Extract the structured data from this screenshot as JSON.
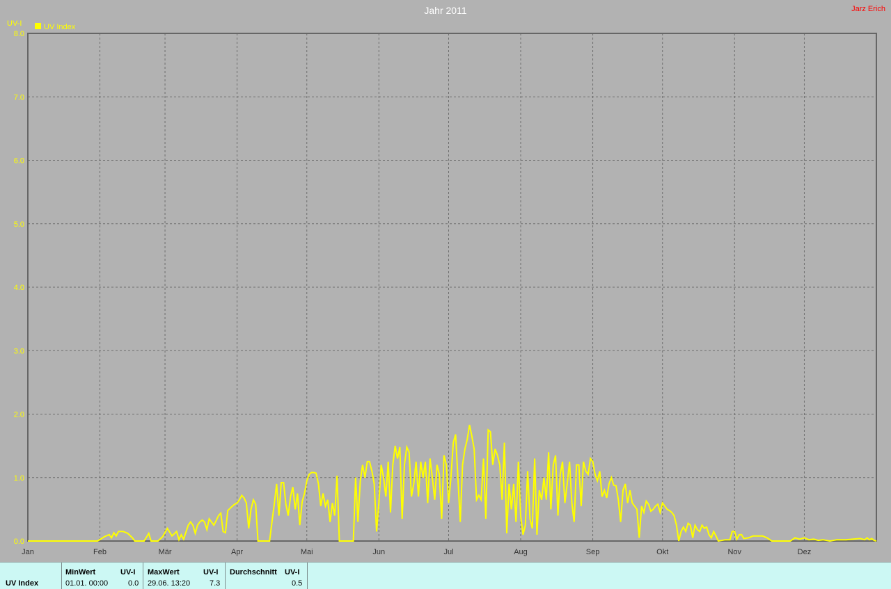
{
  "owner": "Jarz Erich",
  "chart_data": {
    "type": "line",
    "title": "Jahr 2011",
    "ylabel": "UV-I",
    "ylim": [
      0,
      8
    ],
    "yticks": [
      "0.0",
      "1.0",
      "2.0",
      "3.0",
      "4.0",
      "5.0",
      "6.0",
      "7.0",
      "8.0"
    ],
    "x_ticks": [
      "Jan",
      "Feb",
      "Mär",
      "Apr",
      "Mai",
      "Jun",
      "Jul",
      "Aug",
      "Sep",
      "Okt",
      "Nov",
      "Dez"
    ],
    "month_start_day": [
      0,
      31,
      59,
      90,
      120,
      151,
      181,
      212,
      243,
      273,
      304,
      334
    ],
    "xlim_days": [
      0,
      365
    ],
    "grid": true,
    "legend_position": "top-left",
    "series": [
      {
        "name": "UV Index",
        "color": "#ffff00",
        "points": [
          [
            0,
            0.0
          ],
          [
            30,
            0.0
          ],
          [
            33,
            0.07
          ],
          [
            35,
            0.1
          ],
          [
            36,
            0.05
          ],
          [
            37,
            0.13
          ],
          [
            38,
            0.08
          ],
          [
            39,
            0.15
          ],
          [
            41,
            0.15
          ],
          [
            43,
            0.12
          ],
          [
            45,
            0.05
          ],
          [
            46,
            0.0
          ],
          [
            50,
            0.0
          ],
          [
            52,
            0.12
          ],
          [
            53,
            0.0
          ],
          [
            56,
            0.0
          ],
          [
            58,
            0.07
          ],
          [
            60,
            0.2
          ],
          [
            62,
            0.08
          ],
          [
            64,
            0.15
          ],
          [
            65,
            0.02
          ],
          [
            66,
            0.1
          ],
          [
            67,
            0.03
          ],
          [
            69,
            0.25
          ],
          [
            70,
            0.3
          ],
          [
            71,
            0.25
          ],
          [
            72,
            0.12
          ],
          [
            73,
            0.25
          ],
          [
            74,
            0.3
          ],
          [
            75,
            0.33
          ],
          [
            76,
            0.3
          ],
          [
            77,
            0.18
          ],
          [
            78,
            0.35
          ],
          [
            79,
            0.3
          ],
          [
            80,
            0.25
          ],
          [
            81,
            0.32
          ],
          [
            82,
            0.4
          ],
          [
            83,
            0.44
          ],
          [
            84,
            0.15
          ],
          [
            85,
            0.13
          ],
          [
            86,
            0.48
          ],
          [
            88,
            0.55
          ],
          [
            89,
            0.58
          ],
          [
            90,
            0.6
          ],
          [
            91,
            0.65
          ],
          [
            92,
            0.72
          ],
          [
            93,
            0.68
          ],
          [
            94,
            0.6
          ],
          [
            95,
            0.2
          ],
          [
            96,
            0.5
          ],
          [
            97,
            0.65
          ],
          [
            98,
            0.58
          ],
          [
            99,
            0.0
          ],
          [
            104,
            0.0
          ],
          [
            105,
            0.3
          ],
          [
            106,
            0.58
          ],
          [
            107,
            0.9
          ],
          [
            108,
            0.4
          ],
          [
            109,
            0.92
          ],
          [
            110,
            0.92
          ],
          [
            111,
            0.58
          ],
          [
            112,
            0.4
          ],
          [
            113,
            0.7
          ],
          [
            114,
            0.85
          ],
          [
            115,
            0.5
          ],
          [
            116,
            0.75
          ],
          [
            117,
            0.25
          ],
          [
            118,
            0.62
          ],
          [
            119,
            0.75
          ],
          [
            120,
            0.95
          ],
          [
            121,
            1.05
          ],
          [
            122,
            1.08
          ],
          [
            123,
            1.08
          ],
          [
            124,
            1.07
          ],
          [
            125,
            0.9
          ],
          [
            126,
            0.55
          ],
          [
            127,
            0.75
          ],
          [
            128,
            0.55
          ],
          [
            129,
            0.65
          ],
          [
            130,
            0.3
          ],
          [
            131,
            0.6
          ],
          [
            132,
            0.4
          ],
          [
            133,
            1.03
          ],
          [
            134,
            0.0
          ],
          [
            139,
            0.0
          ],
          [
            140,
            0.0
          ],
          [
            141,
            1.0
          ],
          [
            142,
            0.3
          ],
          [
            143,
            0.95
          ],
          [
            144,
            1.2
          ],
          [
            145,
            1.0
          ],
          [
            146,
            1.25
          ],
          [
            147,
            1.25
          ],
          [
            148,
            1.1
          ],
          [
            149,
            0.9
          ],
          [
            150,
            0.15
          ],
          [
            151,
            0.6
          ],
          [
            152,
            1.2
          ],
          [
            153,
            1.0
          ],
          [
            154,
            0.7
          ],
          [
            155,
            1.25
          ],
          [
            156,
            0.45
          ],
          [
            157,
            1.2
          ],
          [
            158,
            1.5
          ],
          [
            159,
            1.3
          ],
          [
            160,
            1.48
          ],
          [
            161,
            0.35
          ],
          [
            162,
            1.2
          ],
          [
            163,
            1.48
          ],
          [
            164,
            1.4
          ],
          [
            165,
            0.7
          ],
          [
            166,
            0.9
          ],
          [
            167,
            1.25
          ],
          [
            168,
            0.7
          ],
          [
            169,
            1.25
          ],
          [
            170,
            1.0
          ],
          [
            171,
            1.25
          ],
          [
            172,
            0.6
          ],
          [
            173,
            1.3
          ],
          [
            174,
            1.0
          ],
          [
            175,
            0.65
          ],
          [
            176,
            1.2
          ],
          [
            177,
            1.05
          ],
          [
            178,
            0.35
          ],
          [
            179,
            1.35
          ],
          [
            180,
            1.2
          ],
          [
            181,
            0.6
          ],
          [
            182,
            1.0
          ],
          [
            183,
            1.55
          ],
          [
            184,
            1.68
          ],
          [
            185,
            1.0
          ],
          [
            186,
            0.3
          ],
          [
            187,
            1.2
          ],
          [
            188,
            1.45
          ],
          [
            189,
            1.6
          ],
          [
            190,
            1.83
          ],
          [
            191,
            1.65
          ],
          [
            192,
            1.45
          ],
          [
            193,
            0.65
          ],
          [
            194,
            0.72
          ],
          [
            195,
            0.65
          ],
          [
            196,
            1.3
          ],
          [
            197,
            0.35
          ],
          [
            198,
            1.75
          ],
          [
            199,
            1.72
          ],
          [
            200,
            1.2
          ],
          [
            201,
            1.45
          ],
          [
            202,
            1.35
          ],
          [
            203,
            1.2
          ],
          [
            204,
            0.65
          ],
          [
            205,
            1.55
          ],
          [
            206,
            0.12
          ],
          [
            207,
            0.9
          ],
          [
            208,
            0.5
          ],
          [
            209,
            0.9
          ],
          [
            210,
            0.3
          ],
          [
            211,
            1.25
          ],
          [
            212,
            0.4
          ],
          [
            213,
            0.1
          ],
          [
            214,
            0.25
          ],
          [
            215,
            1.1
          ],
          [
            216,
            0.35
          ],
          [
            217,
            0.2
          ],
          [
            218,
            1.3
          ],
          [
            219,
            0.1
          ],
          [
            220,
            0.8
          ],
          [
            221,
            0.65
          ],
          [
            222,
            1.0
          ],
          [
            223,
            0.65
          ],
          [
            224,
            1.4
          ],
          [
            225,
            0.5
          ],
          [
            226,
            1.2
          ],
          [
            227,
            1.35
          ],
          [
            228,
            0.4
          ],
          [
            229,
            1.05
          ],
          [
            230,
            1.25
          ],
          [
            231,
            0.6
          ],
          [
            232,
            0.9
          ],
          [
            233,
            1.25
          ],
          [
            234,
            0.6
          ],
          [
            235,
            0.3
          ],
          [
            236,
            1.2
          ],
          [
            237,
            1.2
          ],
          [
            238,
            0.55
          ],
          [
            239,
            1.25
          ],
          [
            240,
            1.1
          ],
          [
            241,
            1.05
          ],
          [
            242,
            1.3
          ],
          [
            243,
            1.25
          ],
          [
            244,
            1.05
          ],
          [
            245,
            0.95
          ],
          [
            246,
            1.1
          ],
          [
            247,
            0.7
          ],
          [
            248,
            0.8
          ],
          [
            249,
            0.68
          ],
          [
            250,
            0.9
          ],
          [
            251,
            1.0
          ],
          [
            252,
            0.88
          ],
          [
            253,
            0.87
          ],
          [
            254,
            0.65
          ],
          [
            255,
            0.3
          ],
          [
            256,
            0.8
          ],
          [
            257,
            0.9
          ],
          [
            258,
            0.6
          ],
          [
            259,
            0.8
          ],
          [
            260,
            0.6
          ],
          [
            261,
            0.55
          ],
          [
            262,
            0.5
          ],
          [
            263,
            0.05
          ],
          [
            264,
            0.55
          ],
          [
            265,
            0.45
          ],
          [
            266,
            0.63
          ],
          [
            267,
            0.58
          ],
          [
            268,
            0.47
          ],
          [
            269,
            0.5
          ],
          [
            270,
            0.55
          ],
          [
            271,
            0.58
          ],
          [
            272,
            0.45
          ],
          [
            273,
            0.6
          ],
          [
            274,
            0.55
          ],
          [
            275,
            0.5
          ],
          [
            276,
            0.48
          ],
          [
            277,
            0.45
          ],
          [
            278,
            0.4
          ],
          [
            279,
            0.25
          ],
          [
            280,
            0.0
          ],
          [
            281,
            0.15
          ],
          [
            282,
            0.22
          ],
          [
            283,
            0.15
          ],
          [
            284,
            0.28
          ],
          [
            285,
            0.25
          ],
          [
            286,
            0.05
          ],
          [
            287,
            0.25
          ],
          [
            288,
            0.18
          ],
          [
            289,
            0.15
          ],
          [
            290,
            0.25
          ],
          [
            291,
            0.2
          ],
          [
            292,
            0.22
          ],
          [
            293,
            0.1
          ],
          [
            294,
            0.05
          ],
          [
            295,
            0.15
          ],
          [
            296,
            0.08
          ],
          [
            297,
            0.0
          ],
          [
            300,
            0.02
          ],
          [
            302,
            0.02
          ],
          [
            303,
            0.15
          ],
          [
            304,
            0.15
          ],
          [
            305,
            0.03
          ],
          [
            306,
            0.1
          ],
          [
            307,
            0.1
          ],
          [
            308,
            0.04
          ],
          [
            310,
            0.05
          ],
          [
            312,
            0.08
          ],
          [
            316,
            0.08
          ],
          [
            318,
            0.05
          ],
          [
            320,
            0.0
          ],
          [
            328,
            0.0
          ],
          [
            330,
            0.05
          ],
          [
            332,
            0.03
          ],
          [
            334,
            0.05
          ],
          [
            336,
            0.02
          ],
          [
            338,
            0.03
          ],
          [
            340,
            0.01
          ],
          [
            342,
            0.02
          ],
          [
            345,
            0.0
          ],
          [
            348,
            0.02
          ],
          [
            352,
            0.02
          ],
          [
            355,
            0.03
          ],
          [
            358,
            0.04
          ],
          [
            360,
            0.02
          ],
          [
            361,
            0.05
          ],
          [
            362,
            0.02
          ],
          [
            363,
            0.04
          ],
          [
            364,
            0.01
          ],
          [
            365,
            0.0
          ]
        ]
      }
    ]
  },
  "summary": {
    "series_label": "UV Index",
    "min": {
      "header": "MinWert",
      "unit": "UV-I",
      "datetime": "01.01.  00:00",
      "value": "0.0"
    },
    "max": {
      "header": "MaxWert",
      "unit": "UV-I",
      "datetime": "29.06.  13:20",
      "value": "7.3"
    },
    "avg": {
      "header": "Durchschnitt",
      "unit": "UV-I",
      "value": "0.5"
    }
  }
}
